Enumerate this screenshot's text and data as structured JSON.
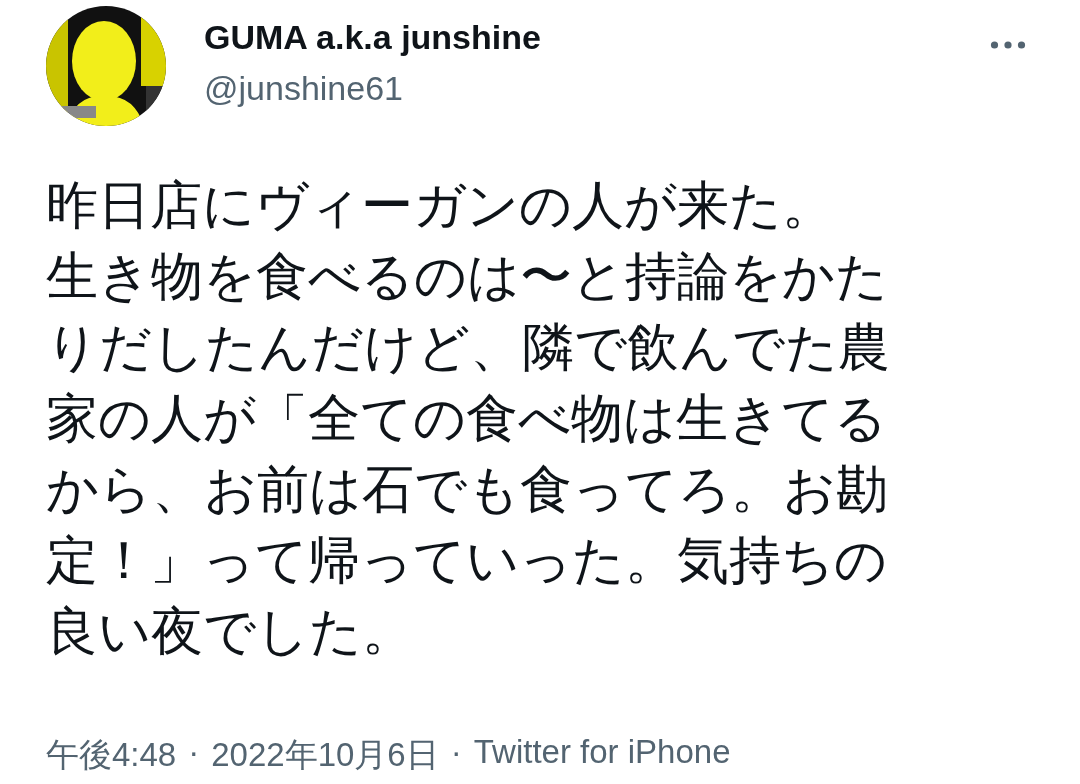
{
  "author": {
    "name": "GUMA a.k.a junshine",
    "handle": "@junshine61"
  },
  "text_lines": [
    "昨日店にヴィーガンの人が来た。",
    "生き物を食べるのは〜と持論をかた",
    "りだしたんだけど、隣で飲んでた農",
    "家の人が「全ての食べ物は生きてる",
    "から、お前は石でも食ってろ。お勘",
    "定！」って帰っていった。気持ちの",
    "良い夜でした。"
  ],
  "meta": {
    "time": "午後4:48",
    "date": "2022年10月6日",
    "source": "Twitter for iPhone",
    "separator": "·"
  }
}
